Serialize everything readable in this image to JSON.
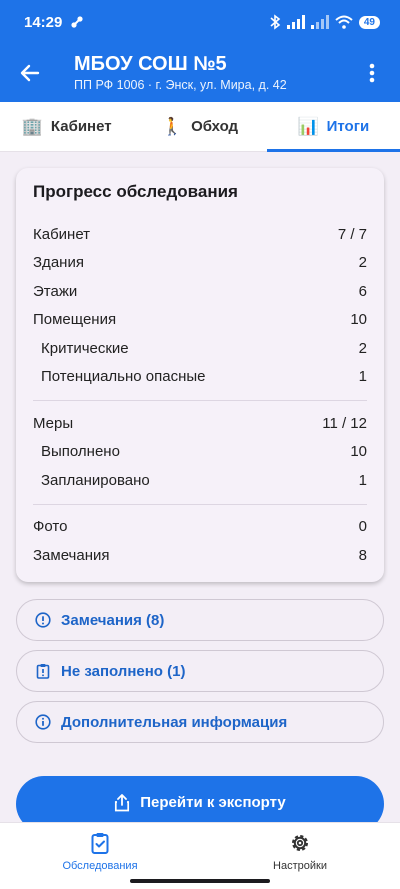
{
  "status": {
    "time": "14:29",
    "battery": "49"
  },
  "appbar": {
    "title": "МБОУ СОШ №5",
    "subtitle": "ПП РФ 1006 · г. Энск, ул. Мира, д. 42"
  },
  "tabs": [
    {
      "label": "Кабинет",
      "icon": "building-icon"
    },
    {
      "label": "Обход",
      "icon": "walking-person-icon"
    },
    {
      "label": "Итоги",
      "icon": "bar-chart-icon"
    }
  ],
  "progress": {
    "title": "Прогресс обследования",
    "rows": [
      {
        "label": "Кабинет",
        "value": "7 / 7"
      },
      {
        "label": "Здания",
        "value": "2"
      },
      {
        "label": "Этажи",
        "value": "6"
      },
      {
        "label": "Помещения",
        "value": "10"
      },
      {
        "label": "Критические",
        "value": "2"
      },
      {
        "label": "Потенциально опасные",
        "value": "1"
      },
      {
        "label": "Меры",
        "value": "11 / 12"
      },
      {
        "label": "Выполнено",
        "value": "10"
      },
      {
        "label": "Запланировано",
        "value": "1"
      },
      {
        "label": "Фото",
        "value": "0"
      },
      {
        "label": "Замечания",
        "value": "8"
      }
    ]
  },
  "actions": {
    "remarks": "Замечания (8)",
    "not_filled": "Не заполнено (1)",
    "additional_info": "Дополнительная информация"
  },
  "export": {
    "label": "Перейти к экспорту"
  },
  "bottom_nav": [
    {
      "label": "Обследования"
    },
    {
      "label": "Настройки"
    }
  ],
  "colors": {
    "primary": "#1e73e8",
    "surface": "#f3eef6"
  }
}
